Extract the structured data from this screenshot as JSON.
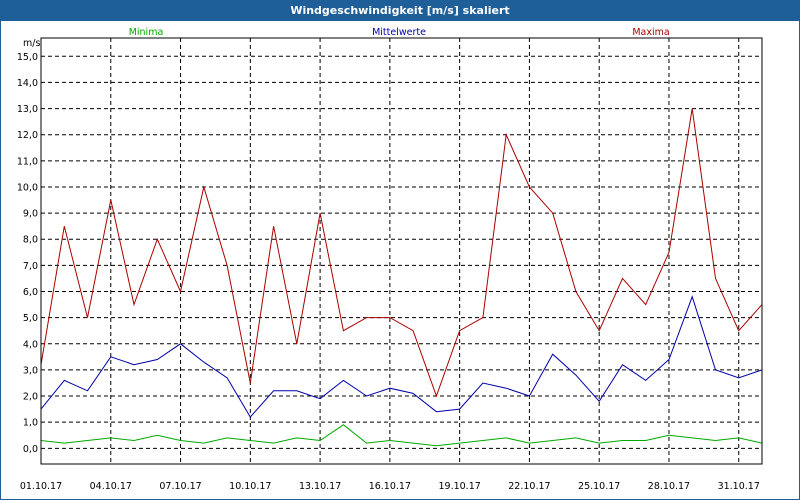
{
  "window": {
    "title": "Windgeschwindigkeit [m/s] skaliert"
  },
  "colors": {
    "titlebar": "#1f5f99",
    "minima": "#00aa00",
    "mittelwerte": "#0000aa",
    "maxima": "#aa0000",
    "grid": "#000000"
  },
  "chart_data": {
    "type": "line",
    "title": "Windgeschwindigkeit [m/s] skaliert",
    "ylabel": "m/s",
    "xlabel": "",
    "ylim": [
      -0.6,
      15.7
    ],
    "y_ticks": [
      0.0,
      1.0,
      2.0,
      3.0,
      4.0,
      5.0,
      6.0,
      7.0,
      8.0,
      9.0,
      10.0,
      11.0,
      12.0,
      13.0,
      14.0,
      15.0
    ],
    "y_tick_labels": [
      "0,0",
      "1,0",
      "2,0",
      "3,0",
      "4,0",
      "5,0",
      "6,0",
      "7,0",
      "8,0",
      "9,0",
      "10,0",
      "11,0",
      "12,0",
      "13,0",
      "14,0",
      "15,0"
    ],
    "xlim": [
      "2017-10-01",
      "2017-11-01"
    ],
    "x_ticks": [
      "2017-10-01",
      "2017-10-04",
      "2017-10-07",
      "2017-10-10",
      "2017-10-13",
      "2017-10-16",
      "2017-10-19",
      "2017-10-22",
      "2017-10-25",
      "2017-10-28",
      "2017-10-31"
    ],
    "x_tick_labels": [
      "01.10.17",
      "04.10.17",
      "07.10.17",
      "10.10.17",
      "13.10.17",
      "16.10.17",
      "19.10.17",
      "22.10.17",
      "25.10.17",
      "28.10.17",
      "31.10.17"
    ],
    "grid": true,
    "legend_position": "top",
    "x": [
      "2017-10-01",
      "2017-10-02",
      "2017-10-03",
      "2017-10-04",
      "2017-10-05",
      "2017-10-06",
      "2017-10-07",
      "2017-10-08",
      "2017-10-09",
      "2017-10-10",
      "2017-10-11",
      "2017-10-12",
      "2017-10-13",
      "2017-10-14",
      "2017-10-15",
      "2017-10-16",
      "2017-10-17",
      "2017-10-18",
      "2017-10-19",
      "2017-10-20",
      "2017-10-21",
      "2017-10-22",
      "2017-10-23",
      "2017-10-24",
      "2017-10-25",
      "2017-10-26",
      "2017-10-27",
      "2017-10-28",
      "2017-10-29",
      "2017-10-30",
      "2017-10-31",
      "2017-11-01"
    ],
    "series": [
      {
        "name": "Minima",
        "color": "#00aa00",
        "values": [
          0.3,
          0.2,
          0.3,
          0.4,
          0.3,
          0.5,
          0.3,
          0.2,
          0.4,
          0.3,
          0.2,
          0.4,
          0.3,
          0.9,
          0.2,
          0.3,
          0.2,
          0.1,
          0.2,
          0.3,
          0.4,
          0.2,
          0.3,
          0.4,
          0.2,
          0.3,
          0.3,
          0.5,
          0.4,
          0.3,
          0.4,
          0.2
        ]
      },
      {
        "name": "Mittelwerte",
        "color": "#0000aa",
        "values": [
          1.5,
          2.6,
          2.2,
          3.5,
          3.2,
          3.4,
          4.0,
          3.3,
          2.7,
          1.2,
          2.2,
          2.2,
          1.9,
          2.6,
          2.0,
          2.3,
          2.1,
          1.4,
          1.5,
          2.5,
          2.3,
          2.0,
          3.6,
          2.8,
          1.8,
          3.2,
          2.6,
          3.4,
          5.8,
          3.0,
          2.7,
          3.0
        ]
      },
      {
        "name": "Maxima",
        "color": "#aa0000",
        "values": [
          3.2,
          8.5,
          5.0,
          9.5,
          5.5,
          8.0,
          6.0,
          10.0,
          7.0,
          2.5,
          8.5,
          4.0,
          9.0,
          4.5,
          5.0,
          5.0,
          4.5,
          2.0,
          4.5,
          5.0,
          12.0,
          10.0,
          9.0,
          6.0,
          4.5,
          6.5,
          5.5,
          7.5,
          13.0,
          6.5,
          4.5,
          5.5
        ]
      }
    ]
  }
}
